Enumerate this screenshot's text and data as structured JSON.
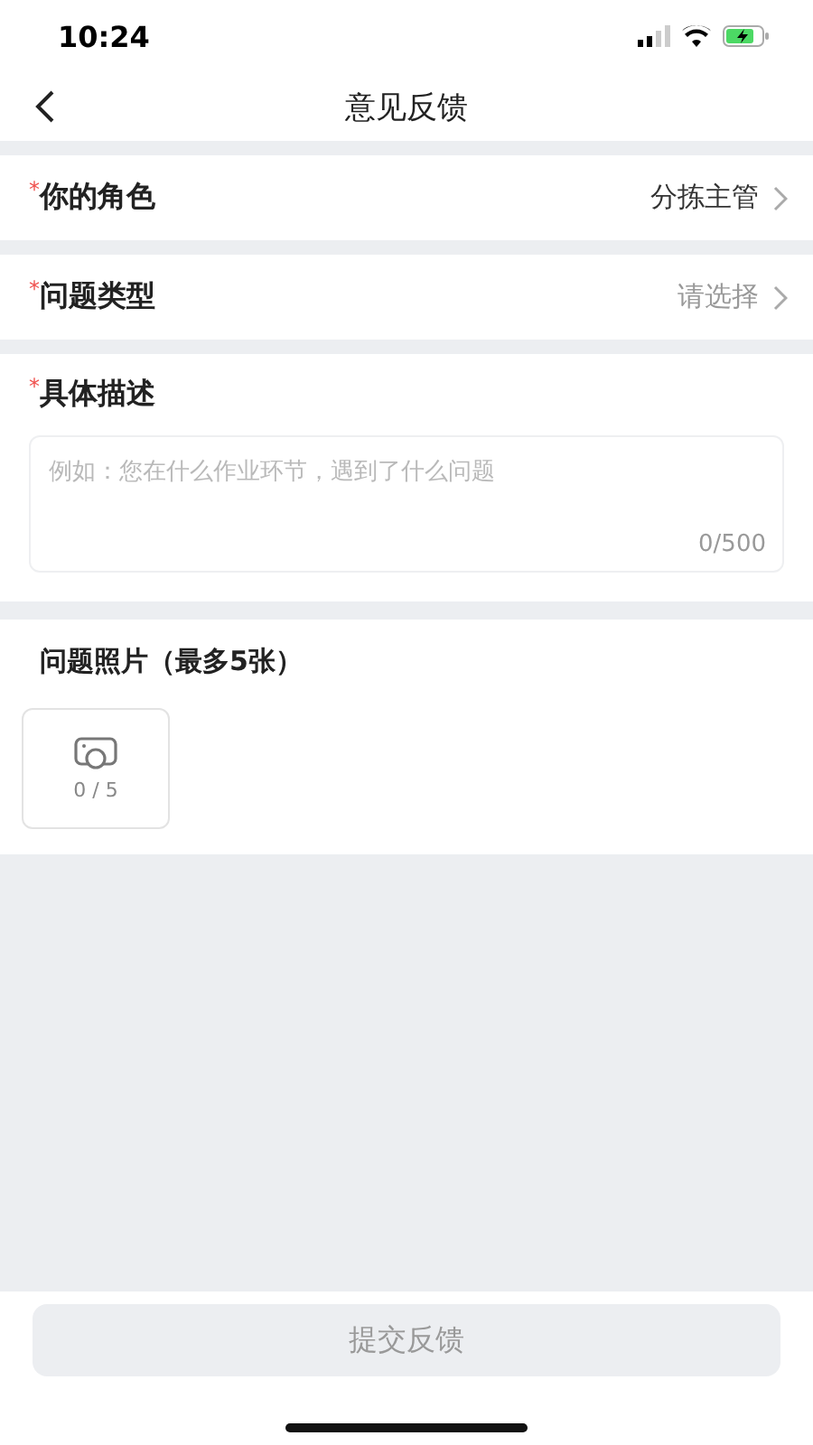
{
  "status_bar": {
    "time": "10:24"
  },
  "nav": {
    "title": "意见反馈"
  },
  "rows": [
    {
      "mark": "*",
      "label": "你的角色",
      "value": "分拣主管",
      "filled": true
    },
    {
      "mark": "*",
      "label": "问题类型",
      "value": "请选择",
      "filled": false
    }
  ],
  "description": {
    "mark": "*",
    "label": "具体描述",
    "placeholder": "例如：您在什么作业环节，遇到了什么问题",
    "counter": "0/500"
  },
  "photos": {
    "label": "问题照片（最多5张）",
    "count": "0 / 5"
  },
  "submit": {
    "label": "提交反馈",
    "disabled": true
  }
}
